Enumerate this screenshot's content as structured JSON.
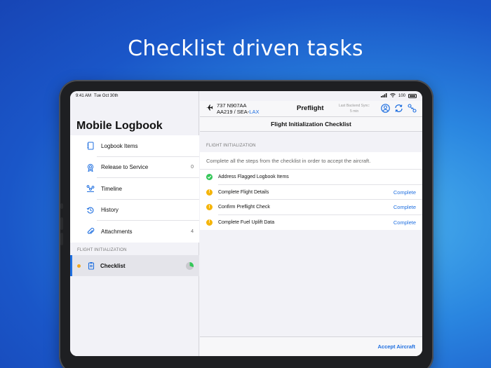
{
  "headline": "Checklist driven tasks",
  "status_bar": {
    "time": "9:41 AM",
    "date": "Tue Oct 30th",
    "battery": "100"
  },
  "sidebar": {
    "title": "Mobile Logbook",
    "items": [
      {
        "label": "Logbook Items",
        "icon": "notebook-icon",
        "count": ""
      },
      {
        "label": "Release to Service",
        "icon": "badge-icon",
        "count": "0"
      },
      {
        "label": "Timeline",
        "icon": "timeline-icon",
        "count": ""
      },
      {
        "label": "History",
        "icon": "history-clock-icon",
        "count": ""
      },
      {
        "label": "Attachments",
        "icon": "paperclip-icon",
        "count": "4"
      }
    ],
    "section_header": "FLIGHT INITIALIZATION",
    "active_item": {
      "label": "Checklist",
      "icon": "clipboard-icon",
      "progress": 0.3
    }
  },
  "header": {
    "aircraft": "737 N907AA",
    "flight": "AA219 / SEA-",
    "destination": "LAX",
    "phase": "Preflight",
    "sync_label": "Last Backend Sync:",
    "sync_value": "5 min"
  },
  "main": {
    "title": "Flight Initialization Checklist",
    "section_header": "FLIGHT INITIALIZATION",
    "instructions": "Complete all the steps from the checklist in order to accept the aircraft.",
    "steps": [
      {
        "label": "Address Flagged Logbook Items",
        "status": "done",
        "action": ""
      },
      {
        "label": "Complete Flight Details",
        "status": "pending",
        "action": "Complete"
      },
      {
        "label": "Confirm Preflight Check",
        "status": "pending",
        "action": "Complete"
      },
      {
        "label": "Complete Fuel Uplift Data",
        "status": "pending",
        "action": "Complete"
      }
    ],
    "accept_label": "Accept Aircraft"
  },
  "colors": {
    "accent": "#1f6fe0",
    "success": "#34c759",
    "warning": "#f5b50a"
  }
}
